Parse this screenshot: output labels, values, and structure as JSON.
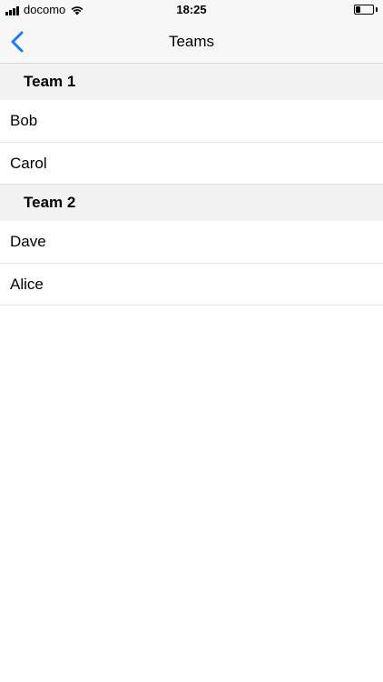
{
  "status_bar": {
    "carrier": "docomo",
    "time": "18:25",
    "battery_level": 0.25,
    "icons": [
      "signal-icon",
      "wifi-icon",
      "battery-icon"
    ]
  },
  "nav": {
    "title": "Teams",
    "back_icon": "chevron-left-icon",
    "accent_color": "#1a7cf0"
  },
  "sections": [
    {
      "header": "Team 1",
      "members": [
        "Bob",
        "Carol"
      ]
    },
    {
      "header": "Team 2",
      "members": [
        "Dave",
        "Alice"
      ]
    }
  ]
}
